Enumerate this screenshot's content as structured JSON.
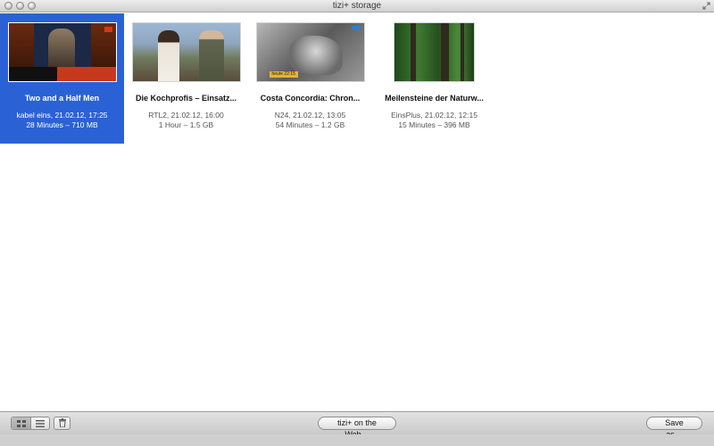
{
  "window": {
    "title": "tizi+ storage",
    "controls": [
      "close-icon",
      "minimize-icon",
      "zoom-icon",
      "fullscreen-icon"
    ]
  },
  "recordings": [
    {
      "title": "Two and a Half Men",
      "channel_time": "kabel eins, 21.02.12, 17:25",
      "duration_size": "28 Minutes – 710 MB",
      "selected": true
    },
    {
      "title": "Die Kochprofis – Einsatz...",
      "channel_time": "RTL2, 21.02.12, 16:00",
      "duration_size": "1 Hour – 1.5 GB",
      "selected": false
    },
    {
      "title": "Costa Concordia: Chron...",
      "channel_time": "N24, 21.02.12, 13:05",
      "duration_size": "54 Minutes – 1.2 GB",
      "selected": false,
      "thumb_overlay": "heute 22:15"
    },
    {
      "title": "Meilensteine der Naturw...",
      "channel_time": "EinsPlus, 21.02.12, 12:15",
      "duration_size": "15 Minutes – 396 MB",
      "selected": false
    }
  ],
  "bottombar": {
    "view_modes": [
      "grid-view-icon",
      "list-view-icon"
    ],
    "active_view": "grid-view-icon",
    "web_button": "tizi+ on the Web…",
    "save_button": "Save as…"
  },
  "colors": {
    "selection": "#2a62d5",
    "selection_text": "#ffffff"
  }
}
